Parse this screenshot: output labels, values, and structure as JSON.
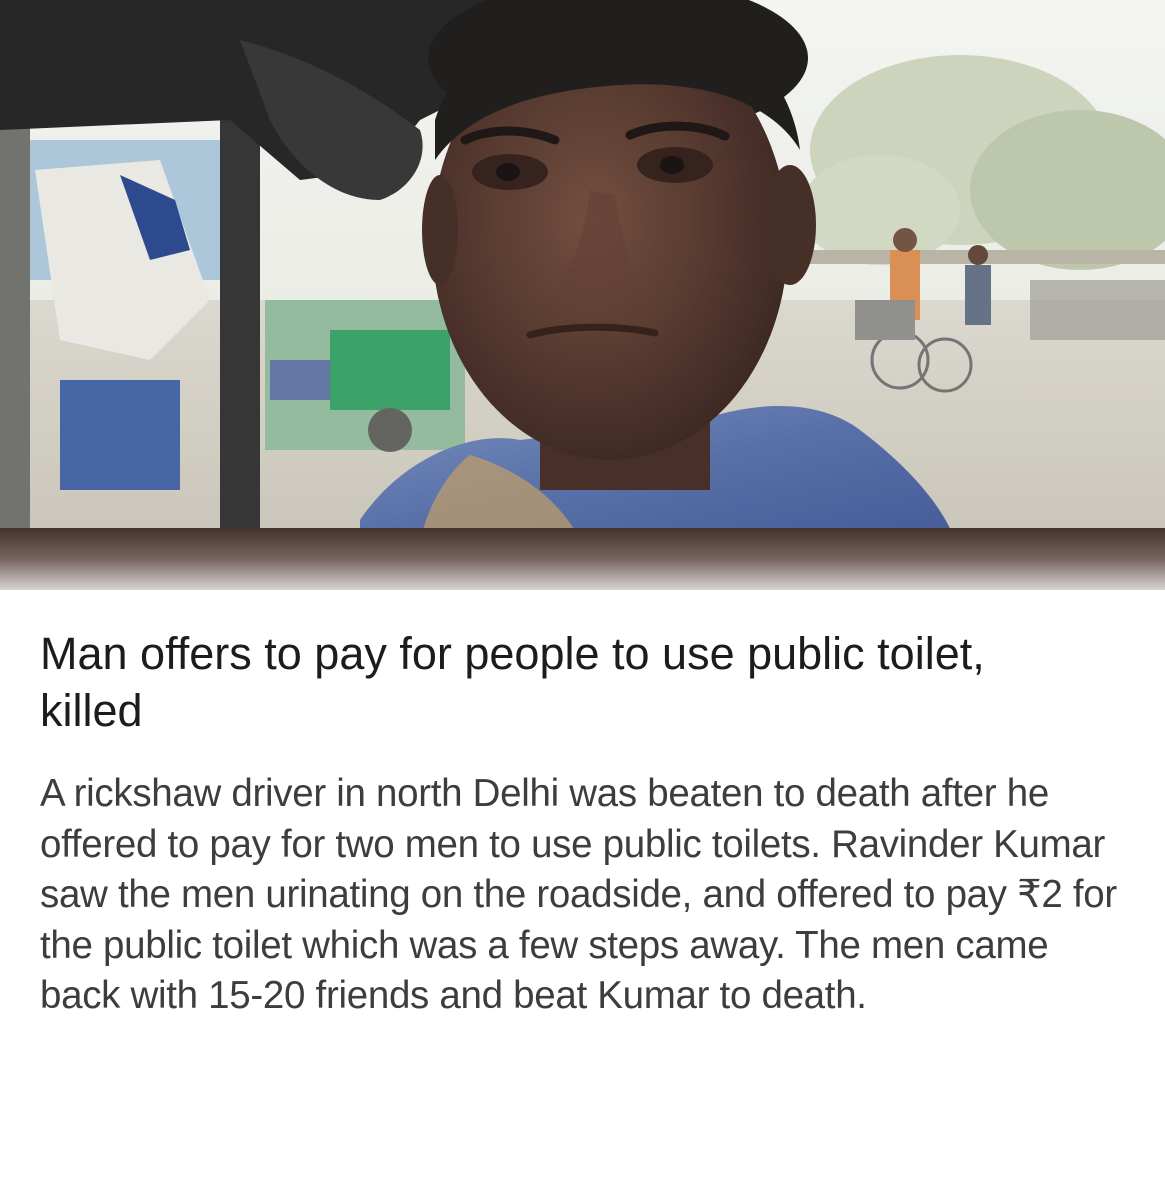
{
  "article": {
    "headline": "Man offers to pay for people to use public toilet, killed",
    "body": "A rickshaw driver in north Delhi was beaten to death after he offered to pay for two men to use public toilets. Ravinder Kumar saw the men urinating on the roadside, and offered to pay ₹2 for the public toilet which was a few steps away. The men came back with 15-20 friends and beat Kumar to death."
  },
  "colors": {
    "headline": "#1c1c1c",
    "body": "#3d3d3d",
    "background": "#ffffff"
  }
}
